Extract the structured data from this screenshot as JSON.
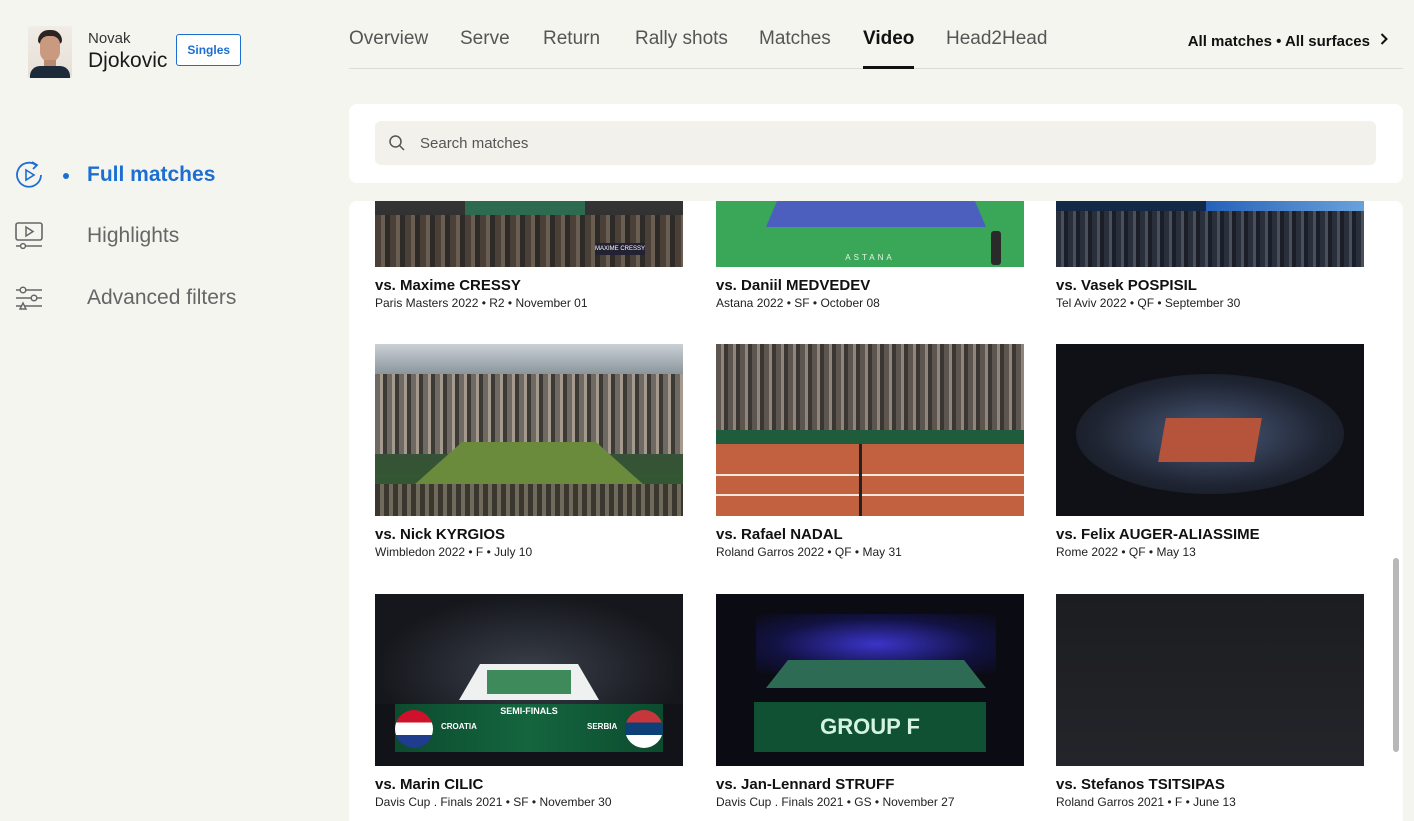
{
  "player": {
    "first_name": "Novak",
    "last_name": "Djokovic",
    "mode_badge": "Singles"
  },
  "tabs": [
    {
      "label": "Overview",
      "active": false
    },
    {
      "label": "Serve",
      "active": false
    },
    {
      "label": "Return",
      "active": false
    },
    {
      "label": "Rally shots",
      "active": false
    },
    {
      "label": "Matches",
      "active": false
    },
    {
      "label": "Video",
      "active": true
    },
    {
      "label": "Head2Head",
      "active": false
    }
  ],
  "filter_summary": "All matches • All surfaces",
  "sidebar": {
    "items": [
      {
        "label": "Full matches",
        "icon": "play-replay-icon",
        "active": true
      },
      {
        "label": "Highlights",
        "icon": "video-screen-icon",
        "active": false
      },
      {
        "label": "Advanced filters",
        "icon": "sliders-icon",
        "active": false
      }
    ]
  },
  "search": {
    "placeholder": "Search matches",
    "value": ""
  },
  "videos": [
    {
      "title": "vs. Maxime CRESSY",
      "meta": "Paris Masters 2022 • R2 • November 01"
    },
    {
      "title": "vs. Daniil MEDVEDEV",
      "meta": "Astana 2022 • SF • October 08"
    },
    {
      "title": "vs. Vasek POSPISIL",
      "meta": "Tel Aviv 2022 • QF • September 30"
    },
    {
      "title": "vs. Nick KYRGIOS",
      "meta": "Wimbledon 2022 • F • July 10"
    },
    {
      "title": "vs. Rafael NADAL",
      "meta": "Roland Garros 2022 • QF • May 31"
    },
    {
      "title": "vs. Felix AUGER-ALIASSIME",
      "meta": "Rome 2022 • QF • May 13"
    },
    {
      "title": "vs. Marin CILIC",
      "meta": "Davis Cup . Finals 2021 • SF • November 30"
    },
    {
      "title": "vs. Jan-Lennard STRUFF",
      "meta": "Davis Cup . Finals 2021 • GS • November 27"
    },
    {
      "title": "vs. Stefanos TSITSIPAS",
      "meta": "Roland Garros 2021 • F • June 13"
    }
  ],
  "thumb_text": {
    "cressy_bug": "MAXIME CRESSY",
    "medvedev_word": "ASTANA",
    "cilic_banner": "SEMI-FINALS",
    "cilic_left": "CROATIA",
    "cilic_right": "SERBIA",
    "struff_banner": "GROUP F"
  },
  "colors": {
    "accent": "#1c6fd1",
    "background": "#f5f5f0",
    "card": "#ffffff"
  }
}
